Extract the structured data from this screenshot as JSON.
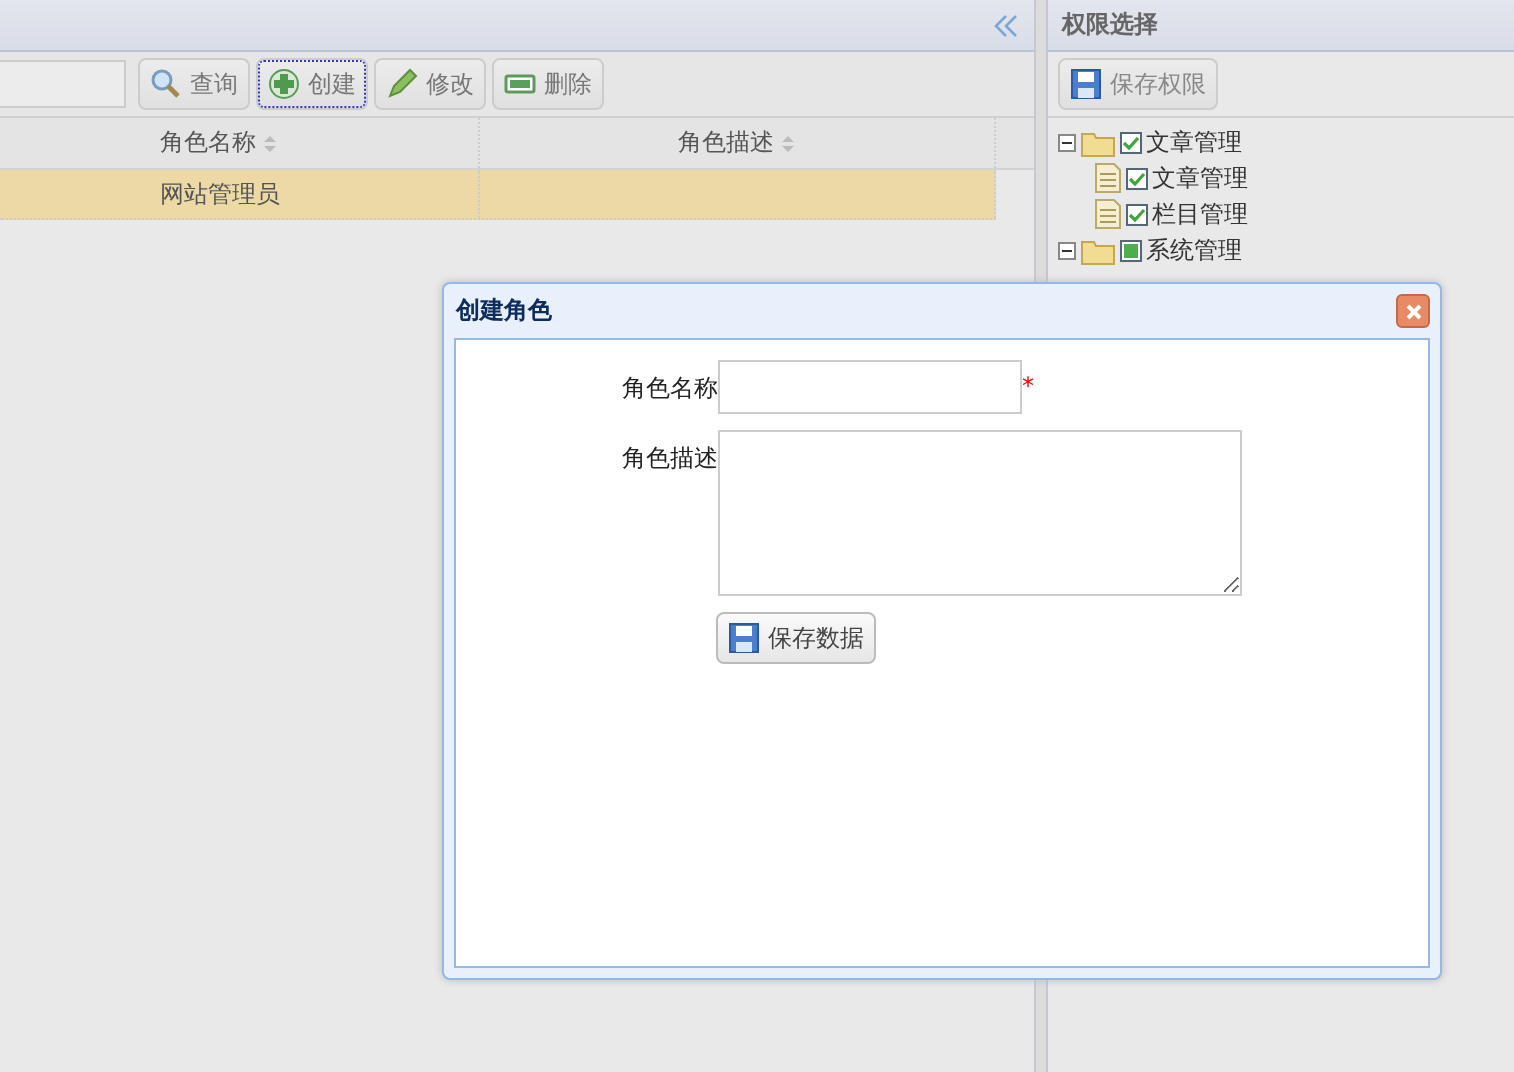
{
  "left_panel": {
    "toolbar": {
      "buttons": [
        {
          "label": "查询",
          "kind": "search",
          "focused": false
        },
        {
          "label": "创建",
          "kind": "add",
          "focused": true
        },
        {
          "label": "修改",
          "kind": "edit",
          "focused": false
        },
        {
          "label": "删除",
          "kind": "remove",
          "focused": false
        }
      ]
    },
    "grid": {
      "columns": [
        {
          "label": "角色名称"
        },
        {
          "label": "角色描述"
        }
      ],
      "rows": [
        {
          "role_name": "网站管理员",
          "selected": true
        }
      ]
    }
  },
  "right_panel": {
    "title": "权限选择",
    "save_button": "保存权限",
    "tree": [
      {
        "kind": "folder",
        "label": "文章管理",
        "checked": true,
        "expanded": true,
        "children": [
          {
            "kind": "document",
            "label": "文章管理",
            "checked": true
          },
          {
            "kind": "document",
            "label": "栏目管理",
            "checked": true
          }
        ]
      },
      {
        "kind": "folder",
        "label": "系统管理",
        "checked": false,
        "partial": true,
        "expanded": true
      }
    ]
  },
  "dialog": {
    "title": "创建角色",
    "fields": [
      {
        "label": "角色名称",
        "kind": "text",
        "required_mark": "*"
      },
      {
        "label": "角色描述",
        "kind": "textarea"
      }
    ],
    "save_button": "保存数据"
  }
}
